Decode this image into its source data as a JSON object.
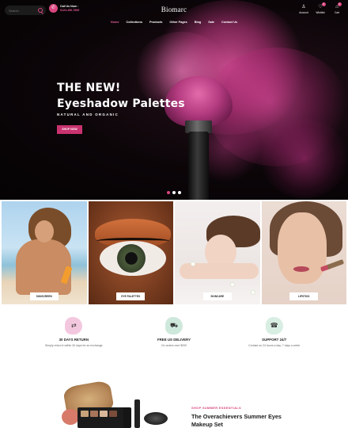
{
  "header": {
    "search_placeholder": "Search",
    "call_label": "Call Us Now :",
    "call_number": "0123-456-7890",
    "logo": "Biomarc",
    "icons": [
      {
        "name": "account",
        "label": "Account",
        "glyph": "♙"
      },
      {
        "name": "wishlist",
        "label": "Wishlist",
        "glyph": "♡",
        "badge": "0"
      },
      {
        "name": "cart",
        "label": "Cart",
        "glyph": "⌂",
        "badge": "0"
      }
    ]
  },
  "nav": {
    "items": [
      "Home",
      "Collections",
      "Products",
      "Other Pages",
      "Blog",
      "Sale",
      "Contact Us"
    ],
    "active": "Home"
  },
  "hero": {
    "title_line1": "THE NEW!",
    "title_line2": "Eyeshadow Palettes",
    "subtitle": "NATURAL AND ORGANIC",
    "button": "SHOP NOW",
    "slides": 3,
    "active_slide": 1
  },
  "categories": [
    {
      "label": "SUNSCREEN"
    },
    {
      "label": "EYE PALETTES"
    },
    {
      "label": "SKINCARE"
    },
    {
      "label": "LIPSTICK"
    }
  ],
  "features": [
    {
      "icon": "exchange-icon",
      "glyph": "⇄",
      "title": "30 DAYS RETURN",
      "desc": "Simply return it within 30 days for an exchange",
      "color": "#f3c8de"
    },
    {
      "icon": "truck-icon",
      "glyph": "⛟",
      "title": "FREE US DELIVERY",
      "desc": "On orders over $200",
      "color": "#cfe8dc"
    },
    {
      "icon": "support-icon",
      "glyph": "☎",
      "title": "SUPPORT 24/7",
      "desc": "Contact us 24 hours a day, 7 days a week",
      "color": "#d8eee3"
    }
  ],
  "promo": {
    "kicker": "SHOP SUMMER ESSENTIALS",
    "title": "The Overachievers Summer Eyes Makeup Set"
  },
  "colors": {
    "accent": "#d9467f",
    "hero_bg": "#0b0508"
  }
}
